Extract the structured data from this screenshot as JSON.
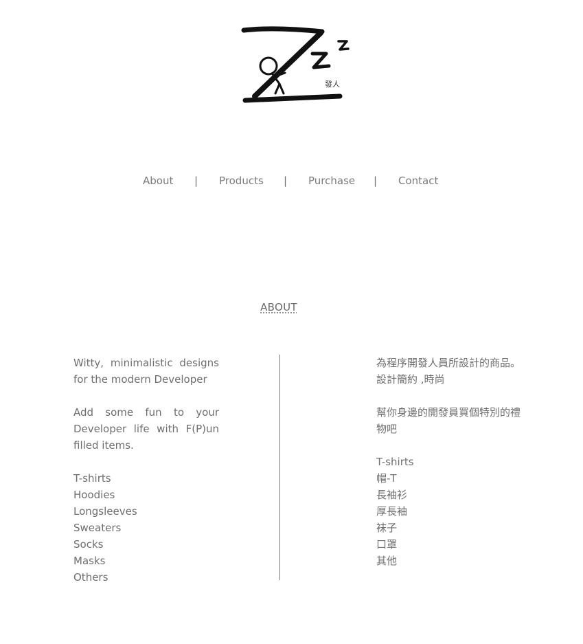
{
  "logo": {
    "alt": "Zzz logo",
    "signature": "發人"
  },
  "nav": {
    "items": [
      "About",
      "Products",
      "Purchase",
      "Contact"
    ],
    "separator": "|"
  },
  "about": {
    "title": "ABOUT",
    "english": {
      "tagline": "Witty, minimalistic designs for the modern Developer",
      "pitch": "Add some fun to your Developer life with F(P)un filled items.",
      "items": [
        "T-shirts",
        "Hoodies",
        "Longsleeves",
        "Sweaters",
        "Socks",
        "Masks",
        "Others"
      ]
    },
    "chinese": {
      "tagline": "為程序開發人員所設計的商品。 設計簡約 ,時尚",
      "pitch": "幫你身邊的開發員買個特別的禮物吧",
      "items": [
        "T-shirts",
        "帽-T",
        "長袖衫",
        "厚長袖",
        "袜子",
        "口罩",
        "其他"
      ]
    }
  },
  "colors": {
    "text": "#6e6e6e",
    "divider": "#777777",
    "logo_ink": "#111111"
  }
}
